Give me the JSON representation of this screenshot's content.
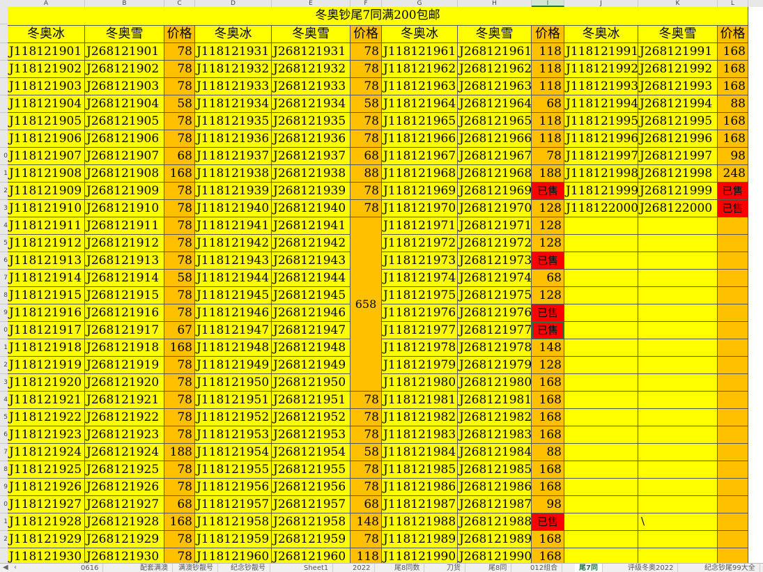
{
  "colors": {
    "yellow": "#ffff00",
    "orange": "#ffc000",
    "red": "#ff0000",
    "grid": "#555555",
    "accent": "#217346"
  },
  "column_letters": [
    "A",
    "B",
    "C",
    "D",
    "E",
    "F",
    "G",
    "H",
    "I",
    "J",
    "K",
    "L"
  ],
  "selected_column": "I",
  "row_numbers": [
    "",
    "",
    "",
    "",
    "",
    "",
    "",
    "",
    "0",
    "1",
    "2",
    "3",
    "4",
    "5",
    "6",
    "7",
    "8",
    "9",
    "0",
    "1",
    "2",
    "3",
    "4",
    "5",
    "6",
    "7",
    "8",
    "9",
    "0",
    "1",
    "2"
  ],
  "title": "冬奥钞尾7同满200包邮",
  "headers": [
    "冬奥冰",
    "冬奥雪",
    "价格",
    "冬奥冰",
    "冬奥雪",
    "价格",
    "冬奥冰",
    "冬奥雪",
    "价格",
    "冬奥冰",
    "冬奥雪",
    "价格"
  ],
  "blocks": [
    {
      "bing": [
        "J118121901",
        "J118121902",
        "J118121903",
        "J118121904",
        "J118121905",
        "J118121906",
        "J118121907",
        "J118121908",
        "J118121909",
        "J118121910",
        "J118121911",
        "J118121912",
        "J118121913",
        "J118121914",
        "J118121915",
        "J118121916",
        "J118121917",
        "J118121918",
        "J118121919",
        "J118121920",
        "J118121921",
        "J118121922",
        "J118121923",
        "J118121924",
        "J118121925",
        "J118121926",
        "J118121927",
        "J118121928",
        "J118121929",
        "J118121930"
      ],
      "xue": [
        "J268121901",
        "J268121902",
        "J268121903",
        "J268121904",
        "J268121905",
        "J268121906",
        "J268121907",
        "J268121908",
        "J268121909",
        "J268121910",
        "J268121911",
        "J268121912",
        "J268121913",
        "J268121914",
        "J268121915",
        "J268121916",
        "J268121917",
        "J268121918",
        "J268121919",
        "J268121920",
        "J268121921",
        "J268121922",
        "J268121923",
        "J268121924",
        "J268121925",
        "J268121926",
        "J268121927",
        "J268121928",
        "J268121929",
        "J268121930"
      ],
      "price": [
        "78",
        "78",
        "78",
        "58",
        "78",
        "78",
        "68",
        "168",
        "78",
        "78",
        "78",
        "78",
        "78",
        "58",
        "78",
        "78",
        "67",
        "168",
        "78",
        "78",
        "78",
        "78",
        "78",
        "188",
        "78",
        "78",
        "68",
        "168",
        "78",
        "78"
      ]
    },
    {
      "bing": [
        "J118121931",
        "J118121932",
        "J118121933",
        "J118121934",
        "J118121935",
        "J118121936",
        "J118121937",
        "J118121938",
        "J118121939",
        "J118121940",
        "J118121941",
        "J118121942",
        "J118121943",
        "J118121944",
        "J118121945",
        "J118121946",
        "J118121947",
        "J118121948",
        "J118121949",
        "J118121950",
        "J118121951",
        "J118121952",
        "J118121953",
        "J118121954",
        "J118121955",
        "J118121956",
        "J118121957",
        "J118121958",
        "J118121959",
        "J118121960"
      ],
      "xue": [
        "J268121931",
        "J268121932",
        "J268121933",
        "J268121934",
        "J268121935",
        "J268121936",
        "J268121937",
        "J268121938",
        "J268121939",
        "J268121940",
        "J268121941",
        "J268121942",
        "J268121943",
        "J268121944",
        "J268121945",
        "J268121946",
        "J268121947",
        "J268121948",
        "J268121949",
        "J268121950",
        "J268121951",
        "J268121952",
        "J268121953",
        "J268121954",
        "J268121955",
        "J268121956",
        "J268121957",
        "J268121958",
        "J268121959",
        "J268121960"
      ],
      "price": [
        "78",
        "78",
        "78",
        "58",
        "78",
        "78",
        "68",
        "88",
        "78",
        "78",
        "",
        "",
        "",
        "",
        "",
        "",
        "",
        "",
        "",
        "",
        "78",
        "78",
        "78",
        "58",
        "78",
        "78",
        "68",
        "148",
        "78",
        "118"
      ],
      "merged_price": "658"
    },
    {
      "bing": [
        "J118121961",
        "J118121962",
        "J118121963",
        "J118121964",
        "J118121965",
        "J118121966",
        "J118121967",
        "J118121968",
        "J118121969",
        "J118121970",
        "J118121971",
        "J118121972",
        "J118121973",
        "J118121974",
        "J118121975",
        "J118121976",
        "J118121977",
        "J118121978",
        "J118121979",
        "J118121980",
        "J118121981",
        "J118121982",
        "J118121983",
        "J118121984",
        "J118121985",
        "J118121986",
        "J118121987",
        "J118121988",
        "J118121989",
        "J118121990"
      ],
      "xue": [
        "J268121961",
        "J268121962",
        "J268121963",
        "J268121964",
        "J268121965",
        "J268121966",
        "J268121967",
        "J268121968",
        "J268121969",
        "J268121970",
        "J268121971",
        "J268121972",
        "J268121973",
        "J268121974",
        "J268121975",
        "J268121976",
        "J268121977",
        "J268121978",
        "J268121979",
        "J268121980",
        "J268121981",
        "J268121982",
        "J268121983",
        "J268121984",
        "J268121985",
        "J268121986",
        "J268121987",
        "J268121988",
        "J268121989",
        "J268121990"
      ],
      "price": [
        "118",
        "118",
        "118",
        "68",
        "118",
        "118",
        "78",
        "188",
        "已售",
        "128",
        "128",
        "128",
        "已售",
        "68",
        "128",
        "已售",
        "已售",
        "148",
        "128",
        "168",
        "168",
        "168",
        "168",
        "88",
        "168",
        "168",
        "98",
        "已售",
        "168",
        "168"
      ]
    },
    {
      "bing": [
        "J118121991",
        "J118121992",
        "J118121993",
        "J118121994",
        "J118121995",
        "J118121996",
        "J118121997",
        "J118121998",
        "J118121999",
        "J118122000"
      ],
      "xue": [
        "J268121991",
        "J268121992",
        "J268121993",
        "J268121994",
        "J268121995",
        "J268121996",
        "J268121997",
        "J268121998",
        "J268121999",
        "J268122000"
      ],
      "price": [
        "168",
        "168",
        "168",
        "88",
        "168",
        "168",
        "98",
        "248",
        "已售",
        "已售"
      ]
    }
  ],
  "stray_mark": "\\",
  "sheet_tabs": [
    "0616",
    "配套满澳",
    "满澳钞靓号",
    "纪念钞靓号",
    "Sheet1",
    "2022",
    "尾8同数",
    "刀货",
    "尾8同",
    "012组合",
    "尾7同",
    "评级冬奥2022",
    "纪念钞尾99大全"
  ],
  "active_tab": "尾7同",
  "tab_nav": {
    "first": "◀",
    "prev": "‹"
  }
}
